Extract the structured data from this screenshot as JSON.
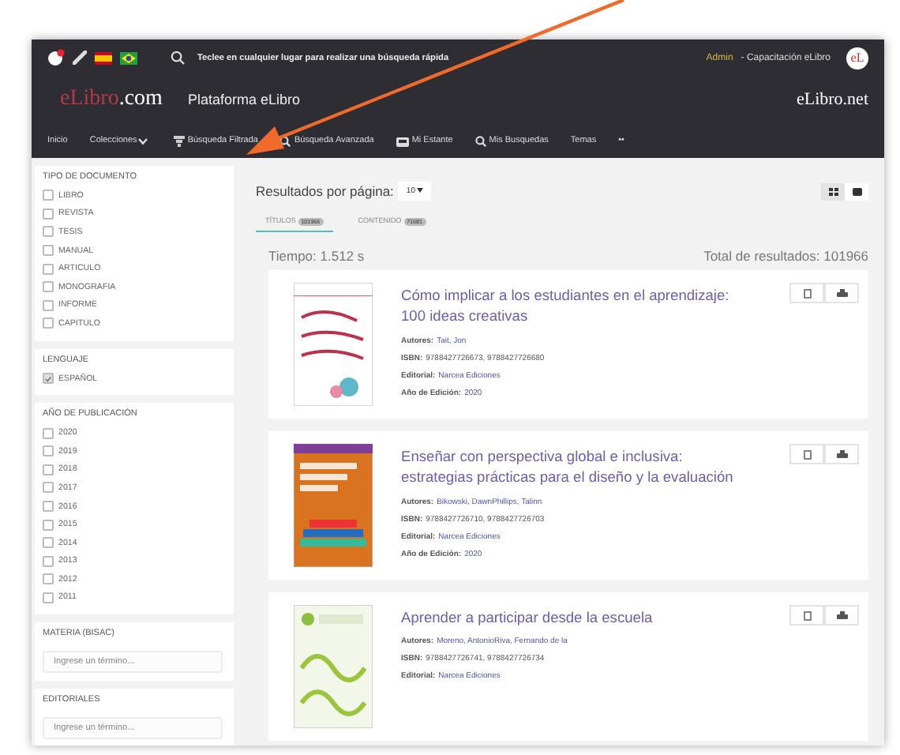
{
  "topbar": {
    "search_hint": "Teclee en cualquier lugar para realizar una búsqueda rápida",
    "user_role": "Admin",
    "user_org": "- Capacitación eLibro",
    "avatar": "eL"
  },
  "brand": {
    "logo_left": "eLibro",
    "logo_right": ".com",
    "platform": "Plataforma eLibro",
    "site": "eLibro.net"
  },
  "nav": [
    {
      "label": "Inicio",
      "kind": "plain"
    },
    {
      "label": "Colecciones",
      "kind": "dropdown"
    },
    {
      "label": "Búsqueda Filtrada",
      "kind": "filter"
    },
    {
      "label": "Búsqueda Avanzada",
      "kind": "search"
    },
    {
      "label": "Mi Estante",
      "kind": "shelf"
    },
    {
      "label": "Mis Busquedas",
      "kind": "search"
    },
    {
      "label": "Temas",
      "kind": "plain"
    },
    {
      "label": "••",
      "kind": "plain"
    }
  ],
  "filters": [
    {
      "title": "TIPO DE DOCUMENTO",
      "kind": "checks",
      "options": [
        {
          "label": "LIBRO",
          "checked": false
        },
        {
          "label": "REVISTA",
          "checked": false
        },
        {
          "label": "TESIS",
          "checked": false
        },
        {
          "label": "MANUAL",
          "checked": false
        },
        {
          "label": "ARTICULO",
          "checked": false
        },
        {
          "label": "MONOGRAFIA",
          "checked": false
        },
        {
          "label": "INFORME",
          "checked": false
        },
        {
          "label": "CAPITULO",
          "checked": false
        }
      ]
    },
    {
      "title": "LENGUAJE",
      "kind": "checks",
      "options": [
        {
          "label": "ESPAÑOL",
          "checked": true
        }
      ]
    },
    {
      "title": "AÑO DE PUBLICACIÓN",
      "kind": "checks",
      "options": [
        {
          "label": "2020",
          "checked": false
        },
        {
          "label": "2019",
          "checked": false
        },
        {
          "label": "2018",
          "checked": false
        },
        {
          "label": "2017",
          "checked": false
        },
        {
          "label": "2016",
          "checked": false
        },
        {
          "label": "2015",
          "checked": false
        },
        {
          "label": "2014",
          "checked": false
        },
        {
          "label": "2013",
          "checked": false
        },
        {
          "label": "2012",
          "checked": false
        },
        {
          "label": "2011",
          "checked": false
        }
      ]
    },
    {
      "title": "MATERIA (BISAC)",
      "kind": "field",
      "placeholder": "Ingrese un término..."
    },
    {
      "title": "EDITORIALES",
      "kind": "field",
      "placeholder": "Ingrese un término..."
    }
  ],
  "results_per_page": {
    "label": "Resultados por página:",
    "value": "10"
  },
  "tabs": [
    {
      "label": "TÍTULOS",
      "count": "101966",
      "selected": true
    },
    {
      "label": "CONTENIDO",
      "count": "71681",
      "selected": false
    }
  ],
  "time": "Tiempo: 1.512 s",
  "total": "Total de resultados: 101966",
  "results": [
    {
      "title": "Cómo implicar a los estudiantes en el aprendizaje: 100 ideas creativas",
      "fields": [
        {
          "label": "Autores:",
          "value": "Tait, Jon",
          "link": true
        },
        {
          "label": "ISBN:",
          "value": "9788427726673, 9788427726680",
          "link": false
        },
        {
          "label": "Editorial:",
          "value": "Narcea Ediciones",
          "link": true
        },
        {
          "label": "Año de Edición:",
          "value": "2020",
          "link": true
        }
      ]
    },
    {
      "title": "Enseñar con perspectiva global e inclusiva: estrategias prácticas para el diseño y la evaluación",
      "fields": [
        {
          "label": "Autores:",
          "value": "Bikowski, DawnPhillips, Talinn",
          "link": true
        },
        {
          "label": "ISBN:",
          "value": "9788427726710, 9788427726703",
          "link": false
        },
        {
          "label": "Editorial:",
          "value": "Narcea Ediciones",
          "link": true
        },
        {
          "label": "Año de Edición:",
          "value": "2020",
          "link": true
        }
      ]
    },
    {
      "title": "Aprender a participar desde la escuela",
      "fields": [
        {
          "label": "Autores:",
          "value": "Moreno, AntonioRiva, Fernando de la",
          "link": true
        },
        {
          "label": "ISBN:",
          "value": "9788427726741, 9788427726734",
          "link": false
        },
        {
          "label": "Editorial:",
          "value": "Narcea Ediciones",
          "link": true
        }
      ]
    }
  ]
}
